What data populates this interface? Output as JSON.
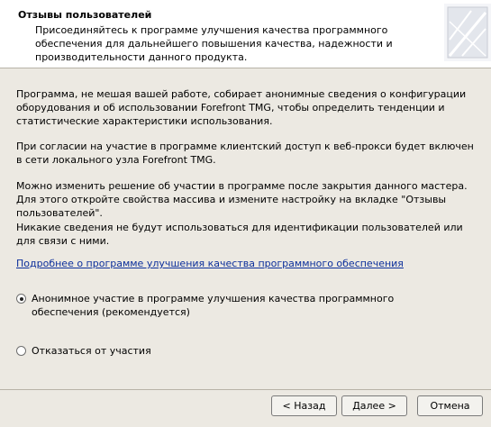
{
  "header": {
    "title": "Отзывы пользователей",
    "description": "Присоединяйтесь к программе улучшения качества программного обеспечения для дальнейшего повышения качества, надежности и производительности данного продукта."
  },
  "body": {
    "paragraph1": "Программа, не мешая вашей работе, собирает анонимные сведения о конфигурации оборудования и об использовании Forefront TMG, чтобы определить тенденции и статистические характеристики использования.",
    "paragraph2": "При согласии на участие в программе клиентский доступ к веб-прокси будет включен в сети локального узла Forefront TMG.",
    "paragraph3": "Можно изменить решение об участии в программе после закрытия данного мастера. Для этого откройте свойства массива и измените настройку на вкладке \"Отзывы пользователей\".",
    "paragraph4": "Никакие сведения не будут использоваться для идентификации пользователей или для связи с ними.",
    "link": "Подробнее о программе улучшения качества программного обеспечения"
  },
  "options": [
    {
      "label": "Анонимное участие в программе улучшения качества программного обеспечения (рекомендуется)",
      "checked": true
    },
    {
      "label": "Отказаться от участия",
      "checked": false
    }
  ],
  "buttons": {
    "back": "< Назад",
    "next": "Далее >",
    "cancel": "Отмена"
  }
}
